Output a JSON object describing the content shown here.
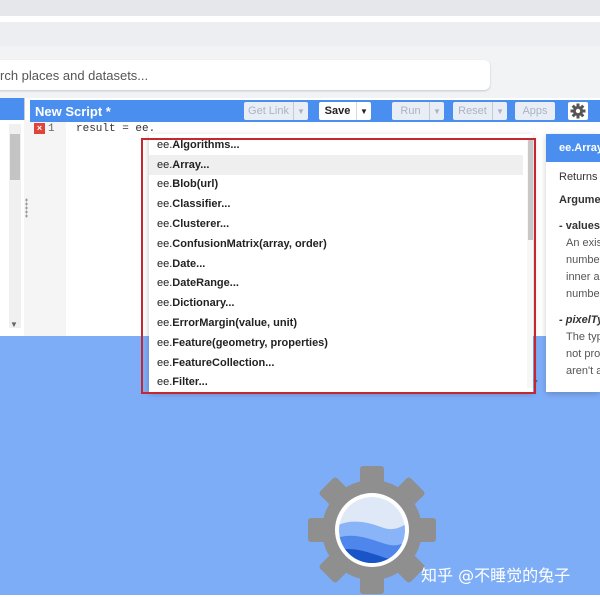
{
  "search": {
    "placeholder": "rch places and datasets..."
  },
  "editor": {
    "title": "New Script *",
    "toolbar": {
      "get_link": "Get Link",
      "save": "Save",
      "run": "Run",
      "reset": "Reset",
      "apps": "Apps"
    },
    "line_number": "1",
    "error_marker": "×",
    "code": "result = ee."
  },
  "autocomplete": {
    "items": [
      {
        "name": "ee.",
        "sig": "Algorithms..."
      },
      {
        "name": "ee.",
        "sig": "Array..."
      },
      {
        "name": "ee.",
        "sig": "Blob(url)"
      },
      {
        "name": "ee.",
        "sig": "Classifier..."
      },
      {
        "name": "ee.",
        "sig": "Clusterer..."
      },
      {
        "name": "ee.",
        "sig": "ConfusionMatrix(array, order)"
      },
      {
        "name": "ee.",
        "sig": "Date..."
      },
      {
        "name": "ee.",
        "sig": "DateRange..."
      },
      {
        "name": "ee.",
        "sig": "Dictionary..."
      },
      {
        "name": "ee.",
        "sig": "ErrorMargin(value, unit)"
      },
      {
        "name": "ee.",
        "sig": "Feature(geometry, properties)"
      },
      {
        "name": "ee.",
        "sig": "FeatureCollection..."
      },
      {
        "name": "ee.",
        "sig": "Filter..."
      }
    ],
    "selected_index": 1
  },
  "docs": {
    "title": "ee.Array",
    "returns": "Returns",
    "arguments": "Argumen",
    "param1_name": "- values",
    "param1_lines": [
      "An exis",
      "numbe",
      "inner a",
      "numbe"
    ],
    "param2_name": "- pixelTy",
    "param2_lines": [
      "The typ",
      "not pro",
      "aren't a"
    ]
  },
  "watermark": "知乎 @不睡觉的兔子",
  "colors": {
    "header_blue": "#4a8ef0",
    "map_blue": "#7eadf8",
    "highlight_red": "#c6262e"
  }
}
